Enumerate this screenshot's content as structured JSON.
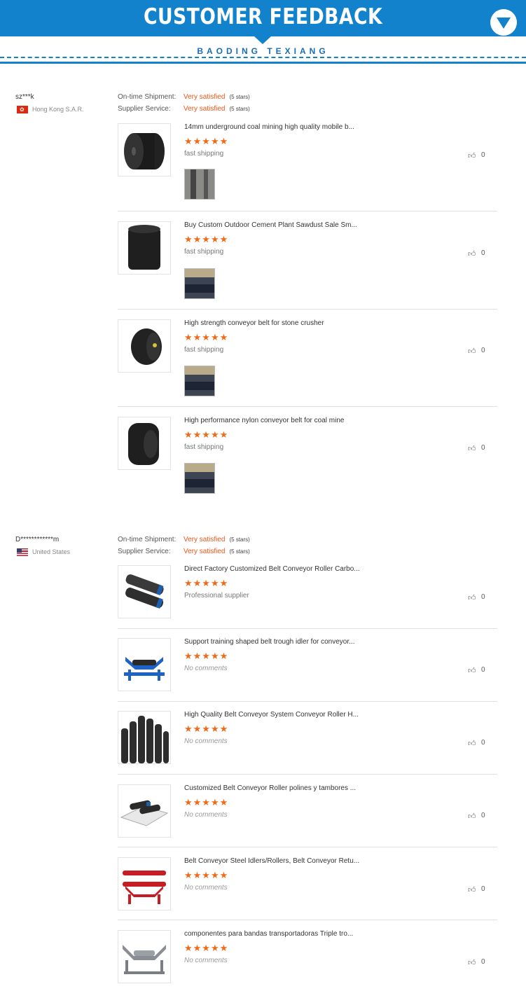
{
  "header": {
    "title": "CUSTOMER FEEDBACK",
    "subtitle": "BAODING TEXIANG",
    "accent_color": "#1282cd",
    "down_icon": "chevron-down-circle-icon"
  },
  "reviews": [
    {
      "buyer": "sz***k",
      "country": "Hong Kong S.A.R.",
      "flag": "hk-flag-icon",
      "shipment_label": "On-time Shipment:",
      "shipment_value": "Very satisfied",
      "shipment_stars": "(5 stars)",
      "service_label": "Supplier Service:",
      "service_value": "Very satisfied",
      "service_stars": "(5 stars)",
      "items": [
        {
          "title": "14mm underground coal mining high quality mobile b...",
          "stars": "★★★★★",
          "comment": "fast shipping",
          "likes": "0",
          "rating": 5
        },
        {
          "title": "Buy Custom Outdoor Cement Plant Sawdust Sale Sm...",
          "stars": "★★★★★",
          "comment": "fast shipping",
          "likes": "0",
          "rating": 5
        },
        {
          "title": "High strength conveyor belt for stone crusher",
          "stars": "★★★★★",
          "comment": "fast shipping",
          "likes": "0",
          "rating": 5
        },
        {
          "title": "High performance nylon conveyor belt for coal mine",
          "stars": "★★★★★",
          "comment": "fast shipping",
          "likes": "0",
          "rating": 5
        }
      ]
    },
    {
      "buyer": "D************m",
      "country": "United States",
      "flag": "us-flag-icon",
      "shipment_label": "On-time Shipment:",
      "shipment_value": "Very satisfied",
      "shipment_stars": "(5 stars)",
      "service_label": "Supplier Service:",
      "service_value": "Very satisfied",
      "service_stars": "(5 stars)",
      "items": [
        {
          "title": "Direct Factory Customized Belt Conveyor Roller Carbo...",
          "stars": "★★★★★",
          "comment": "Professional supplier",
          "likes": "0",
          "rating": 5
        },
        {
          "title": "Support training shaped belt trough idler for conveyor...",
          "stars": "★★★★★",
          "comment": "No comments",
          "likes": "0",
          "rating": 5
        },
        {
          "title": "High Quality Belt Conveyor System Conveyor Roller H...",
          "stars": "★★★★★",
          "comment": "No comments",
          "likes": "0",
          "rating": 5
        },
        {
          "title": "Customized Belt Conveyor Roller polines y tambores ...",
          "stars": "★★★★★",
          "comment": "No comments",
          "likes": "0",
          "rating": 5
        },
        {
          "title": "Belt Conveyor Steel Idlers/Rollers, Belt Conveyor Retu...",
          "stars": "★★★★★",
          "comment": "No comments",
          "likes": "0",
          "rating": 5
        },
        {
          "title": "componentes para bandas transportadoras Triple tro...",
          "stars": "★★★★★",
          "comment": "No comments",
          "likes": "0",
          "rating": 5
        }
      ]
    }
  ]
}
